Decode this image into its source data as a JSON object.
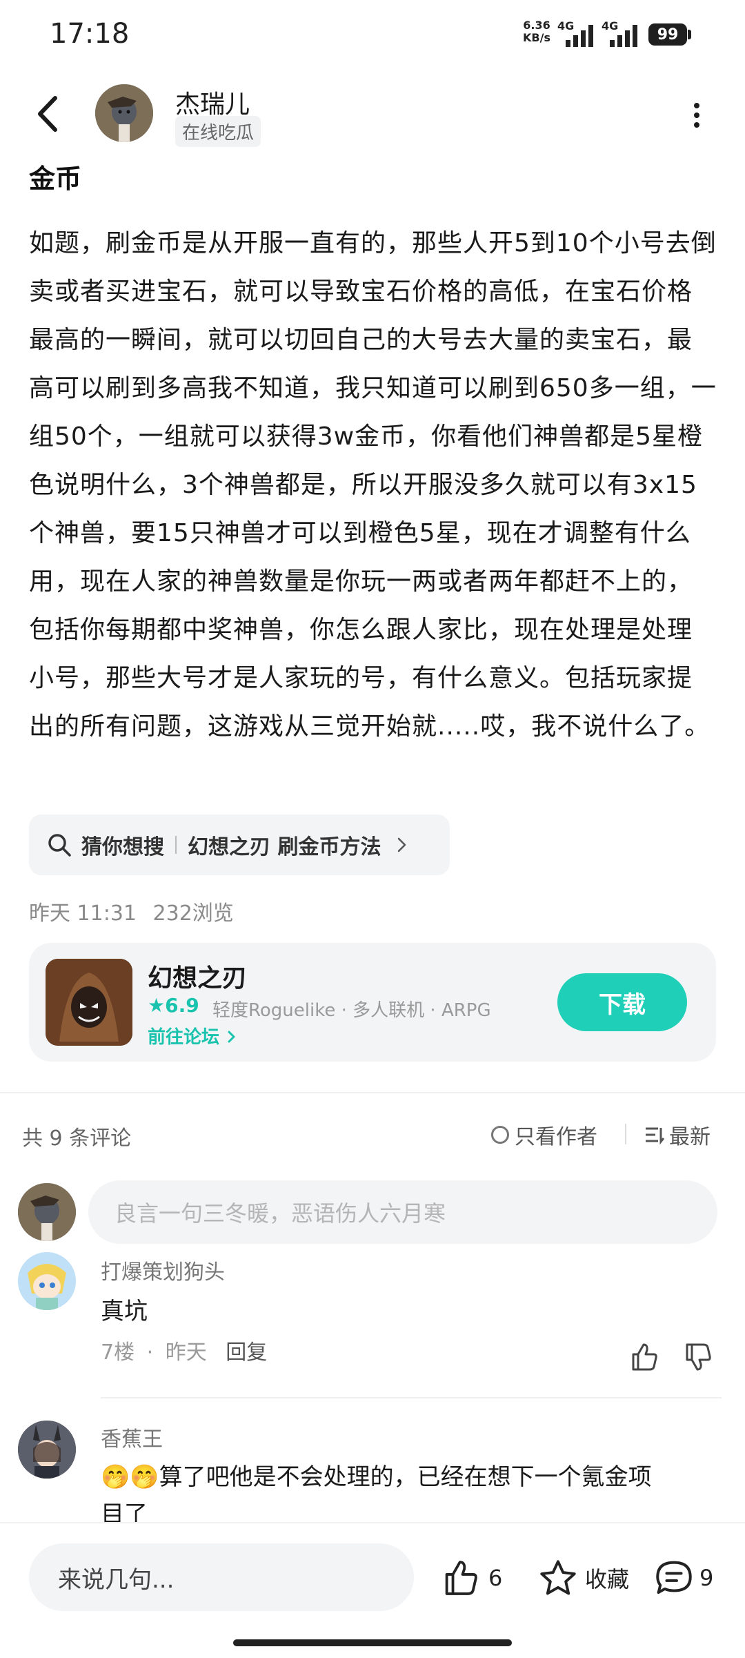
{
  "status_bar": {
    "time": "17:18",
    "net_speed": "6.36",
    "net_unit": "KB/s",
    "signal1_label": "4G",
    "signal2_label": "4G",
    "battery": "99"
  },
  "header": {
    "author_name": "杰瑞儿",
    "author_badge": "在线吃瓜",
    "back_icon": "chevron-left-icon",
    "more_icon": "more-vertical-icon"
  },
  "post": {
    "title": "金币",
    "body": "如题，刷金币是从开服一直有的，那些人开5到10个小号去倒卖或者买进宝石，就可以导致宝石价格的高低，在宝石价格最高的一瞬间，就可以切回自己的大号去大量的卖宝石，最高可以刷到多高我不知道，我只知道可以刷到650多一组，一组50个，一组就可以获得3w金币，你看他们神兽都是5星橙色说明什么，3个神兽都是，所以开服没多久就可以有3x15个神兽，要15只神兽才可以到橙色5星，现在才调整有什么用，现在人家的神兽数量是你玩一两或者两年都赶不上的，包括你每期都中奖神兽，你怎么跟人家比，现在处理是处理小号，那些大号才是人家玩的号，有什么意义。包括玩家提出的所有问题，这游戏从三觉开始就.....哎，我不说什么了。",
    "suggest_label": "猜你想搜",
    "suggest_query": "幻想之刃 刷金币方法",
    "time": "昨天 11:31",
    "views": "232浏览"
  },
  "game_card": {
    "name": "幻想之刃",
    "rating": "6.9",
    "tags": "轻度Roguelike · 多人联机 · ARPG",
    "forum_link": "前往论坛",
    "download_label": "下载"
  },
  "comments_header": {
    "count_text": "共 9 条评论",
    "author_only": "只看作者",
    "sort": "最新",
    "input_placeholder": "良言一句三冬暖，恶语伤人六月寒"
  },
  "comments": [
    {
      "user": "打爆策划狗头",
      "text": "真坑",
      "floor": "7楼",
      "time": "昨天",
      "reply": "回复"
    },
    {
      "user": "香蕉王",
      "emoji": "🤭🤭",
      "text_line1": "算了吧他是不会处理的，已经在想下一个氪金项",
      "text_line2": "目了"
    }
  ],
  "bottom_bar": {
    "input_placeholder": "来说几句...",
    "likes": "6",
    "favorite": "收藏",
    "comments": "9"
  },
  "colors": {
    "accent": "#1fcfb7",
    "accent_text": "#19c3ad",
    "card_bg": "#f3f4f6"
  }
}
